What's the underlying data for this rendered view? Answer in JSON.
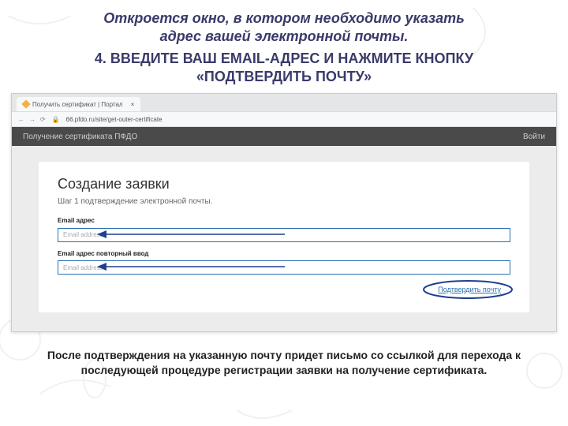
{
  "intro_line1": "Откроется окно, в котором необходимо указать",
  "intro_line2": "адрес вашей электронной почты.",
  "step_line1": "4. ВВЕДИТЕ ВАШ EMAIL-АДРЕС И НАЖМИТЕ КНОПКУ",
  "step_line2": "«ПОДТВЕРДИТЬ ПОЧТУ»",
  "browser": {
    "tab_title": "Получить сертификат | Портал",
    "url": "66.pfdo.ru/site/get-outer-certificate",
    "banner_title": "Получение сертификата ПФДО",
    "login": "Войти"
  },
  "form": {
    "title": "Создание заявки",
    "subtitle": "Шаг 1 подтверждение электронной почты.",
    "email_label": "Email адрес",
    "email_placeholder": "Email address",
    "email_repeat_label": "Email адрес повторный ввод",
    "email_repeat_placeholder": "Email address",
    "confirm_button": "Подтвердить почту"
  },
  "outro": "После подтверждения на указанную почту придет письмо со ссылкой для перехода к  последующей процедуре регистрации заявки на получение сертификата."
}
